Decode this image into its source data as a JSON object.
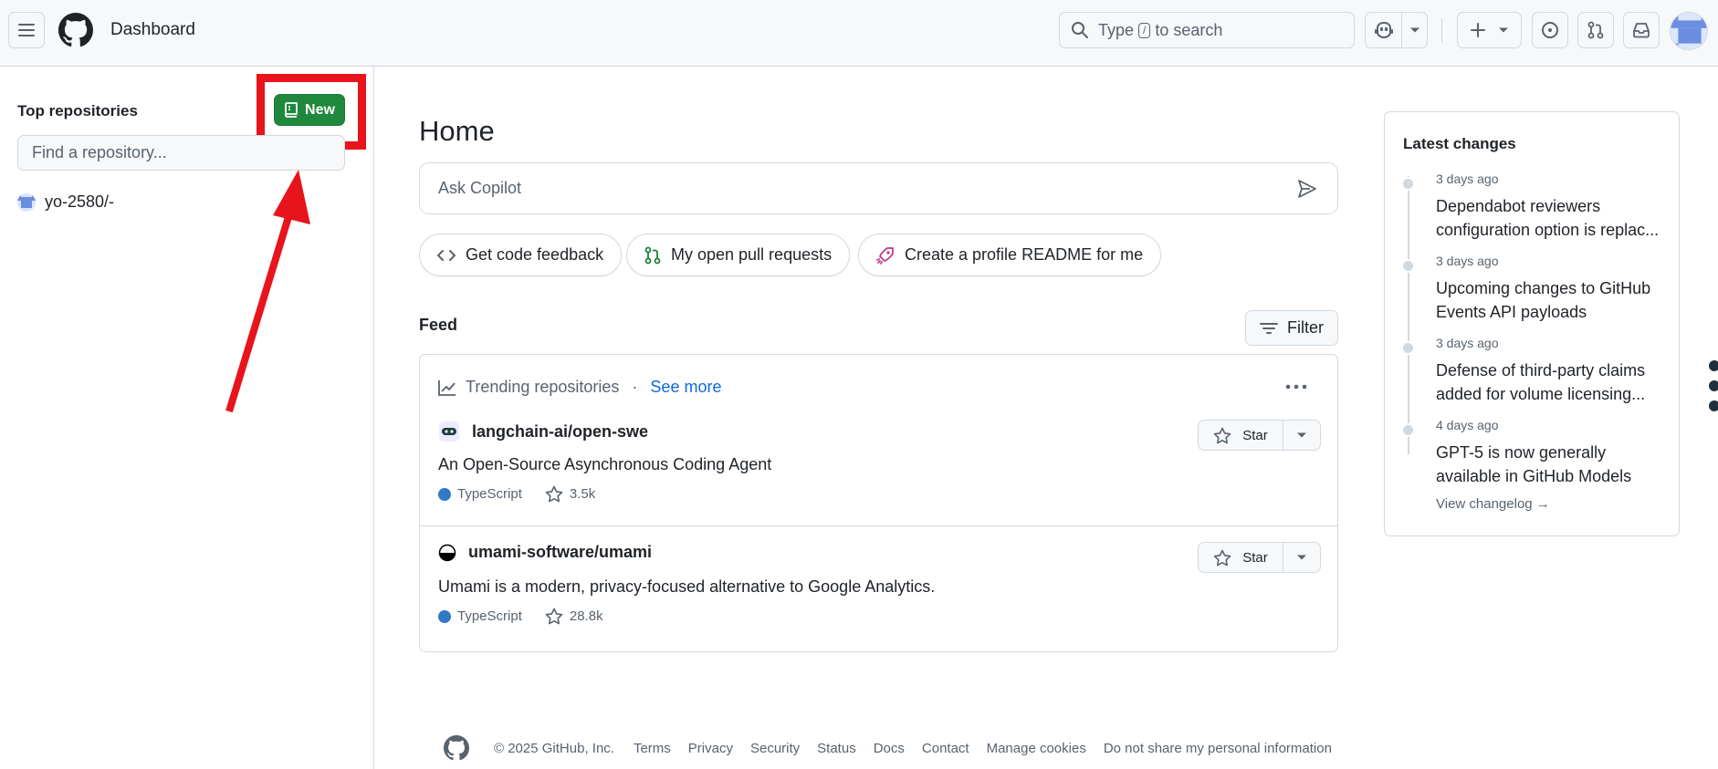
{
  "header": {
    "title": "Dashboard",
    "search_prefix": "Type",
    "search_key": "/",
    "search_suffix": "to search"
  },
  "sidebar": {
    "title": "Top repositories",
    "new_button": "New",
    "find_placeholder": "Find a repository...",
    "repos": [
      {
        "name": "yo-2580/-"
      }
    ]
  },
  "main": {
    "title": "Home",
    "copilot_placeholder": "Ask Copilot",
    "chips": [
      "Get code feedback",
      "My open pull requests",
      "Create a profile README for me"
    ],
    "feed_title": "Feed",
    "filter_label": "Filter",
    "trending": {
      "label": "Trending repositories",
      "separator": "·",
      "see_more": "See more",
      "repos": [
        {
          "name": "langchain-ai/open-swe",
          "description": "An Open-Source Asynchronous Coding Agent",
          "language": "TypeScript",
          "stars": "3.5k",
          "star_label": "Star"
        },
        {
          "name": "umami-software/umami",
          "description": "Umami is a modern, privacy-focused alternative to Google Analytics.",
          "language": "TypeScript",
          "stars": "28.8k",
          "star_label": "Star"
        }
      ]
    }
  },
  "latest_changes": {
    "title": "Latest changes",
    "items": [
      {
        "when": "3 days ago",
        "what": "Dependabot reviewers configuration option is replac..."
      },
      {
        "when": "3 days ago",
        "what": "Upcoming changes to GitHub Events API payloads"
      },
      {
        "when": "3 days ago",
        "what": "Defense of third-party claims added for volume licensing..."
      },
      {
        "when": "4 days ago",
        "what": "GPT-5 is now generally available in GitHub Models"
      }
    ],
    "view_changelog": "View changelog →"
  },
  "footer": {
    "copyright": "© 2025 GitHub, Inc.",
    "links": [
      "Terms",
      "Privacy",
      "Security",
      "Status",
      "Docs",
      "Contact",
      "Manage cookies",
      "Do not share my personal information"
    ]
  },
  "colors": {
    "primary_button": "#1f883d",
    "annotation_red": "#e8141c",
    "link": "#0969da",
    "typescript": "#3178c6"
  }
}
